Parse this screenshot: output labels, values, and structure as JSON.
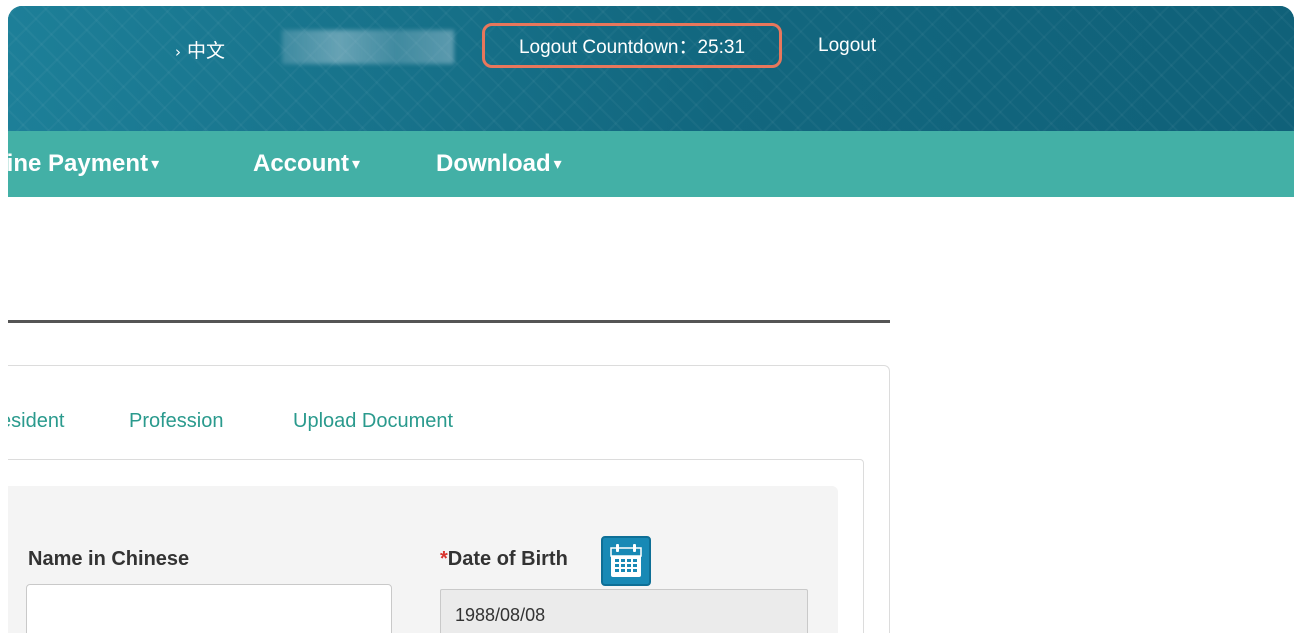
{
  "header": {
    "language_link": "中文",
    "countdown_text": "Logout Countdown：25:31",
    "logout_label": "Logout"
  },
  "nav": {
    "items": [
      {
        "label": "line Payment"
      },
      {
        "label": "Account"
      },
      {
        "label": "Download"
      }
    ]
  },
  "tabs": [
    {
      "label": "esident"
    },
    {
      "label": "Profession"
    },
    {
      "label": "Upload Document"
    }
  ],
  "form": {
    "name_chinese_label": "Name in Chinese",
    "name_chinese_value": "",
    "dob_required_mark": "*",
    "dob_label": "Date of Birth",
    "dob_value": "1988/08/08"
  },
  "colors": {
    "header_bg": "#14708a",
    "nav_bg": "#43b0a6",
    "highlight_border": "#e8775c",
    "tab_text": "#2a9a8d",
    "required": "#d9352f",
    "calendar_button": "#1889b5"
  },
  "icons": {
    "calendar": "calendar-icon",
    "language_chevron": "chevron-right-icon",
    "nav_caret": "caret-down-icon"
  }
}
